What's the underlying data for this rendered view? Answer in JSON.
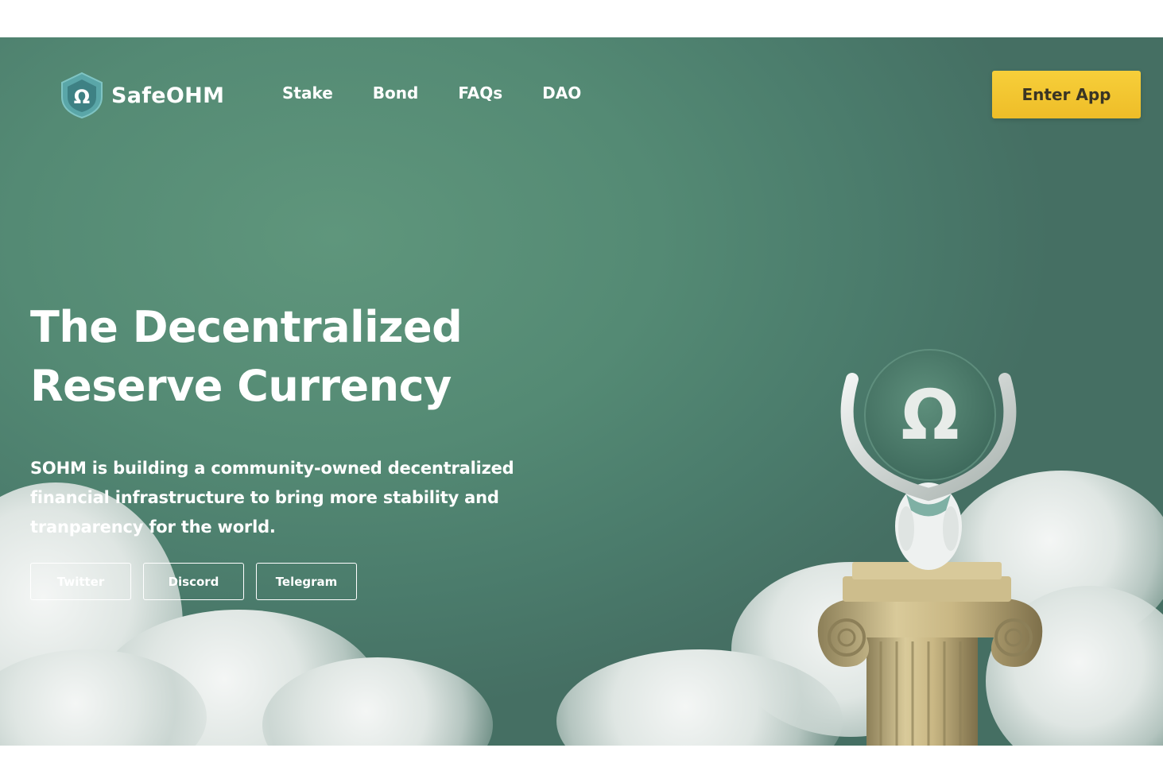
{
  "brand": {
    "name": "SafeOHM",
    "logo_icon": "omega-shield-icon",
    "logo_glyph": "Ω"
  },
  "nav": {
    "links": [
      {
        "label": "Stake"
      },
      {
        "label": "Bond"
      },
      {
        "label": "FAQs"
      },
      {
        "label": "DAO"
      }
    ]
  },
  "header": {
    "cta_label": "Enter App"
  },
  "hero": {
    "title_line1": "The Decentralized",
    "title_line2": "Reserve Currency",
    "description": "SOHM is building a community-owned decentralized financial infrastructure to bring more stability and tranparency for the world.",
    "social_buttons": [
      {
        "label": "Twitter"
      },
      {
        "label": "Discord"
      },
      {
        "label": "Telegram"
      }
    ],
    "illustration_glyph": "Ω"
  },
  "colors": {
    "background": "#548a74",
    "accent": "#f2c42f",
    "text": "#ffffff"
  }
}
